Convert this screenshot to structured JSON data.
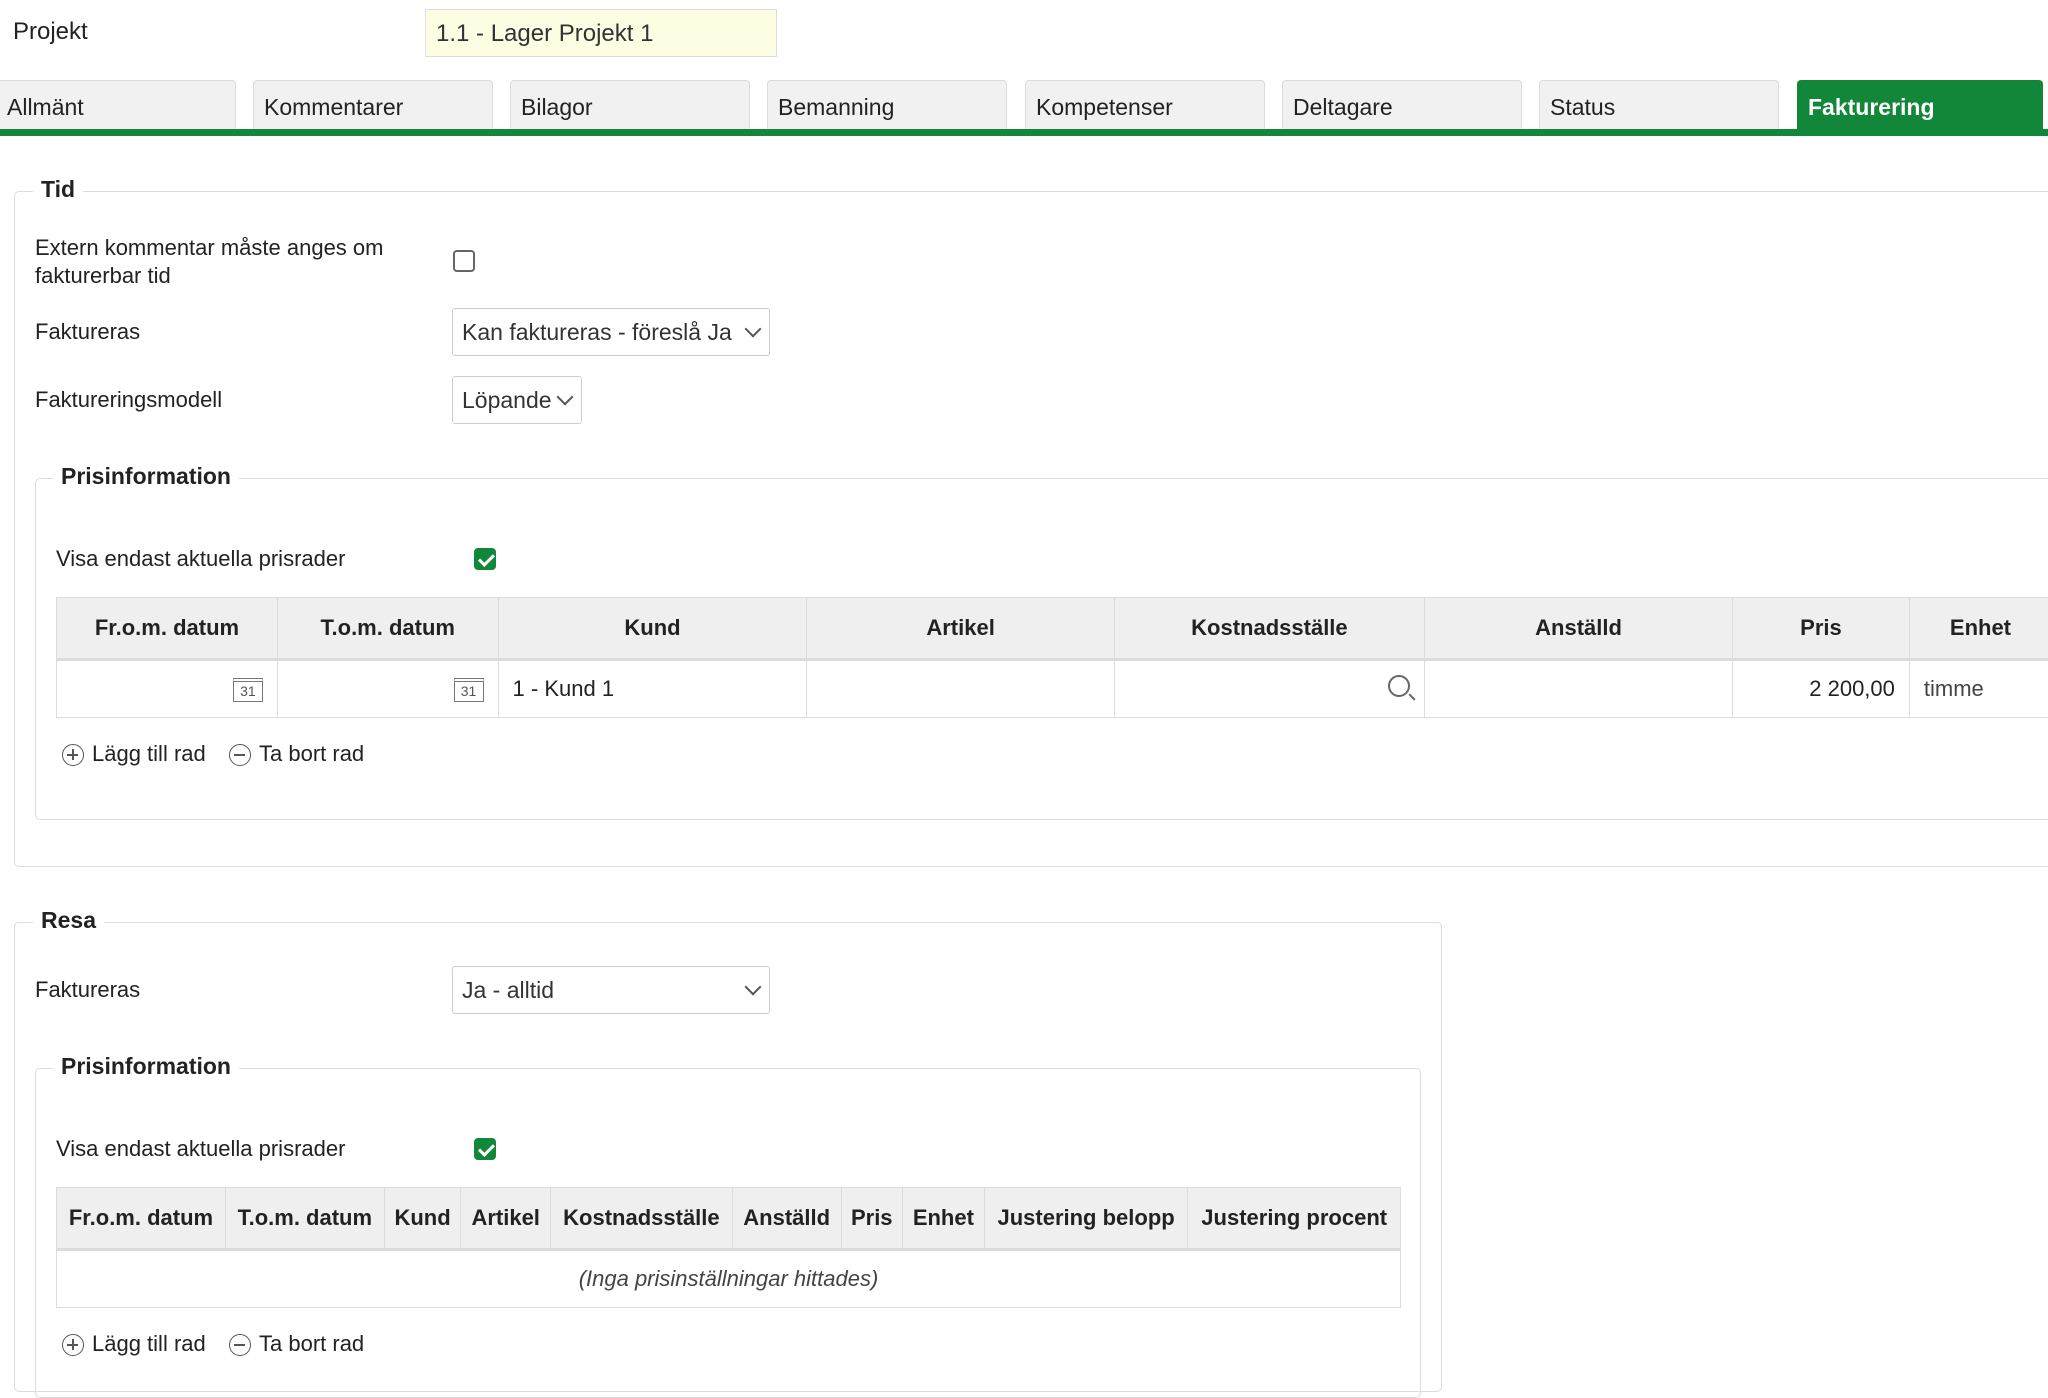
{
  "header": {
    "project_label": "Projekt",
    "project_value": "1.1 - Lager Projekt 1"
  },
  "tabs": [
    "Allmänt",
    "Kommentarer",
    "Bilagor",
    "Bemanning",
    "Kompetenser",
    "Deltagare",
    "Status",
    "Fakturering"
  ],
  "active_tab": "Fakturering",
  "colors": {
    "accent": "#12873a",
    "project_field_bg": "#fdfde4"
  },
  "tid": {
    "legend": "Tid",
    "extern_kommentar_label_1": "Extern kommentar måste anges om",
    "extern_kommentar_label_2": "fakturerbar tid",
    "extern_kommentar_checked": false,
    "faktureras_label": "Faktureras",
    "faktureras_value": "Kan faktureras - föreslå Ja",
    "modell_label": "Faktureringsmodell",
    "modell_value": "Löpande",
    "pris": {
      "legend": "Prisinformation",
      "visa_label": "Visa endast aktuella prisrader",
      "visa_checked": true,
      "columns": [
        "Fr.o.m. datum",
        "T.o.m. datum",
        "Kund",
        "Artikel",
        "Kostnadsställe",
        "Anställd",
        "Pris",
        "Enhet"
      ],
      "row": {
        "kund": "1 - Kund 1",
        "pris": "2 200,00",
        "enhet": "timme",
        "calendar_day": "31"
      },
      "add_row": "Lägg till rad",
      "remove_row": "Ta bort rad"
    }
  },
  "resa": {
    "legend": "Resa",
    "faktureras_label": "Faktureras",
    "faktureras_value": "Ja - alltid",
    "pris": {
      "legend": "Prisinformation",
      "visa_label": "Visa endast aktuella prisrader",
      "visa_checked": true,
      "columns": [
        "Fr.o.m. datum",
        "T.o.m. datum",
        "Kund",
        "Artikel",
        "Kostnadsställe",
        "Anställd",
        "Pris",
        "Enhet",
        "Justering belopp",
        "Justering procent"
      ],
      "empty_text": "(Inga prisinställningar hittades)",
      "add_row": "Lägg till rad",
      "remove_row": "Ta bort rad"
    }
  }
}
